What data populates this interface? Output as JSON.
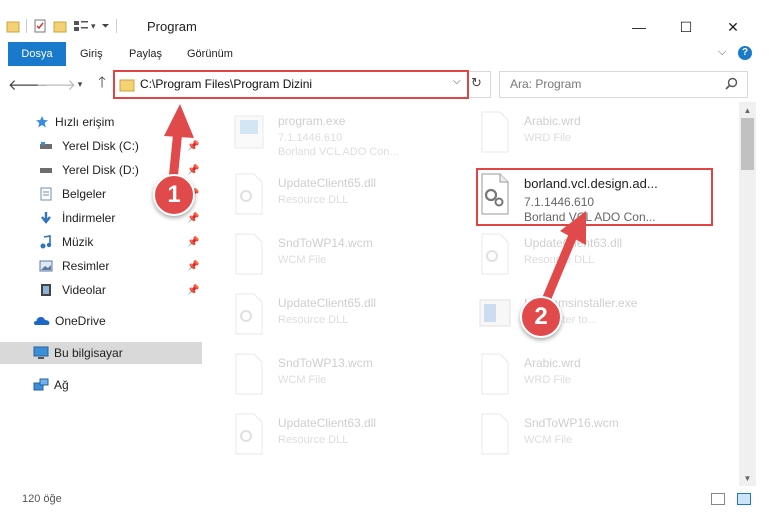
{
  "window": {
    "title": "Program",
    "controls": {
      "minimize": "—",
      "maximize": "☐",
      "close": "✕"
    }
  },
  "ribbon": {
    "tabs": [
      "Dosya",
      "Giriş",
      "Paylaş",
      "Görünüm"
    ],
    "help": "?"
  },
  "nav": {
    "address": "C:\\Program Files\\Program Dizini",
    "search_placeholder": "Ara: Program"
  },
  "sidebar": {
    "items": [
      {
        "label": "Hızlı erişim",
        "icon": "star-icon",
        "pinned": false
      },
      {
        "label": "Yerel Disk (C:)",
        "icon": "drive-icon",
        "pinned": true
      },
      {
        "label": "Yerel Disk (D:)",
        "icon": "drive-icon",
        "pinned": true
      },
      {
        "label": "Belgeler",
        "icon": "documents-icon",
        "pinned": true
      },
      {
        "label": "İndirmeler",
        "icon": "download-icon",
        "pinned": true
      },
      {
        "label": "Müzik",
        "icon": "music-icon",
        "pinned": true
      },
      {
        "label": "Resimler",
        "icon": "pictures-icon",
        "pinned": true
      },
      {
        "label": "Videolar",
        "icon": "videos-icon",
        "pinned": true
      },
      {
        "label": "OneDrive",
        "icon": "onedrive-icon",
        "pinned": false
      },
      {
        "label": "Bu bilgisayar",
        "icon": "computer-icon",
        "pinned": false
      },
      {
        "label": "Ağ",
        "icon": "network-icon",
        "pinned": false
      }
    ]
  },
  "files": [
    {
      "name": "program.exe",
      "line1": "7.1.1446.610",
      "line2": "Borland VCL ADO Con..."
    },
    {
      "name": "Arabic.wrd",
      "line1": "WRD File",
      "line2": ""
    },
    {
      "name": "UpdateClient65.dll",
      "line1": "Resource DLL",
      "line2": ""
    },
    {
      "name": "borland.vcl.design.ad...",
      "line1": "7.1.1446.610",
      "line2": "Borland VCL ADO Con..."
    },
    {
      "name": "SndToWP14.wcm",
      "line1": "WCM File",
      "line2": ""
    },
    {
      "name": "UpdateClient63.dll",
      "line1": "Resource DLL",
      "line2": ""
    },
    {
      "name": "UpdateClient65.dll",
      "line1": "Resource DLL",
      "line2": ""
    },
    {
      "name": "Intermmsinstaller.exe",
      "line1": "Filemaster to...",
      "line2": ""
    },
    {
      "name": "SndToWP13.wcm",
      "line1": "WCM File",
      "line2": ""
    },
    {
      "name": "Arabic.wrd",
      "line1": "WRD File",
      "line2": ""
    },
    {
      "name": "UpdateClient63.dll",
      "line1": "Resource DLL",
      "line2": ""
    },
    {
      "name": "SndToWP16.wcm",
      "line1": "WCM File",
      "line2": ""
    }
  ],
  "status": {
    "count": "120 öğe"
  },
  "annotations": {
    "step1": "1",
    "step2": "2"
  },
  "colors": {
    "accent": "#1979ca",
    "highlight": "#e04545",
    "selection": "#d9d9d9"
  }
}
